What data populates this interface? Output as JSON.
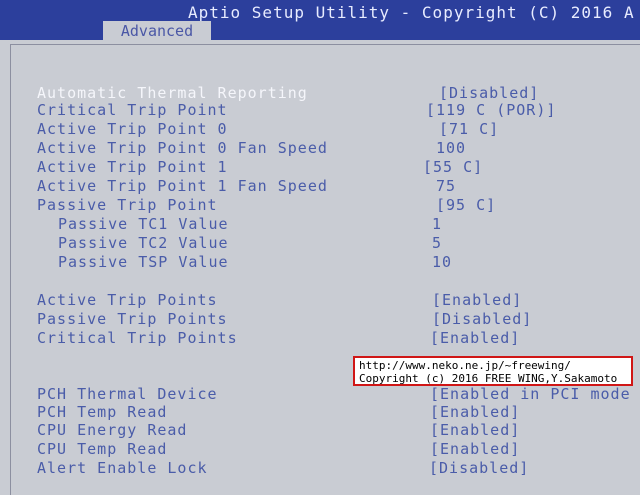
{
  "header": {
    "title": "Aptio Setup Utility - Copyright (C) 2016 A",
    "tab": "Advanced"
  },
  "settings": [
    {
      "label": "Automatic Thermal Reporting",
      "value": "[Disabled]",
      "selected": true
    },
    {
      "label": "Critical Trip Point",
      "value": "[119 C (POR)]"
    },
    {
      "label": "Active Trip Point 0",
      "value": "[71 C]"
    },
    {
      "label": "Active Trip Point 0 Fan Speed",
      "value": "100"
    },
    {
      "label": "Active Trip Point 1",
      "value": "[55 C]"
    },
    {
      "label": "Active Trip Point 1 Fan Speed",
      "value": "75"
    },
    {
      "label": "Passive Trip Point",
      "value": "[95 C]"
    },
    {
      "label": "Passive TC1 Value",
      "value": "1"
    },
    {
      "label": "Passive TC2 Value",
      "value": "5"
    },
    {
      "label": "Passive TSP Value",
      "value": "10"
    },
    {
      "label": "Active Trip Points",
      "value": "[Enabled]"
    },
    {
      "label": "Passive Trip Points",
      "value": "[Disabled]"
    },
    {
      "label": "Critical Trip Points",
      "value": "[Enabled]"
    },
    {
      "label": "PCH Thermal Device",
      "value": "[Enabled in PCI mode"
    },
    {
      "label": "PCH Temp Read",
      "value": "[Enabled]"
    },
    {
      "label": "CPU Energy Read",
      "value": "[Enabled]"
    },
    {
      "label": "CPU Temp Read",
      "value": "[Enabled]"
    },
    {
      "label": "Alert Enable Lock",
      "value": "[Disabled]"
    }
  ],
  "notice": {
    "line1": "http://www.neko.ne.jp/~freewing/",
    "line2": "Copyright (c) 2016 FREE WING,Y.Sakamoto"
  }
}
